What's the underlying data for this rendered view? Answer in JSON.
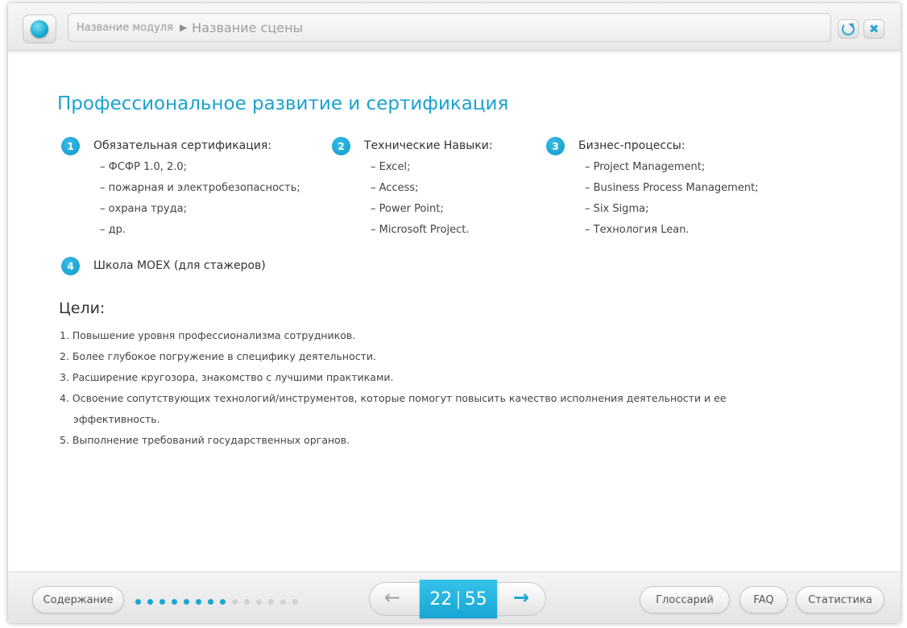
{
  "header": {
    "module_name": "Название модуля",
    "path_separator": "▶",
    "scene_name": "Название сцены"
  },
  "main": {
    "title": "Профессиональное развитие и сертификация",
    "columns": [
      {
        "number": "1",
        "heading": "Обязательная сертификация:",
        "items": [
          "– ФСФР 1.0, 2.0;",
          "– пожарная и электробезопасность;",
          "– охрана труда;",
          "– др."
        ]
      },
      {
        "number": "2",
        "heading": "Технические Навыки:",
        "items": [
          "– Excel;",
          "– Access;",
          "– Power Point;",
          "– Microsoft Project."
        ]
      },
      {
        "number": "3",
        "heading": "Бизнес-процессы:",
        "items": [
          "– Project Management;",
          "– Business Process Management;",
          "– Six Sigma;",
          "– Технология Lean."
        ]
      }
    ],
    "school": {
      "number": "4",
      "heading": "Школа MOEX (для стажеров)"
    },
    "goals": {
      "title": "Цели:",
      "items": [
        "1. Повышение уровня профессионализма сотрудников.",
        "2. Более глубокое погружение в специфику деятельности.",
        "3. Расширение кругозора, знакомство с лучшими практиками.",
        "4. Освоение сопутствующих технологий/инструментов, которые помогут повысить качество исполнения деятельности и ее",
        "эффективность.",
        "5. Выполнение требований государственных органов."
      ]
    }
  },
  "footer": {
    "toc_label": "Содержание",
    "progress_dots_done": 8,
    "progress_dots_total": 14,
    "current_page": "22",
    "page_separator": "|",
    "total_pages": "55",
    "glossary_label": "Глоссарий",
    "faq_label": "FAQ",
    "stats_label": "Статистика"
  },
  "colors": {
    "accent": "#1aa2cf",
    "text": "#444444",
    "dot_inactive": "#d2d2d2"
  }
}
